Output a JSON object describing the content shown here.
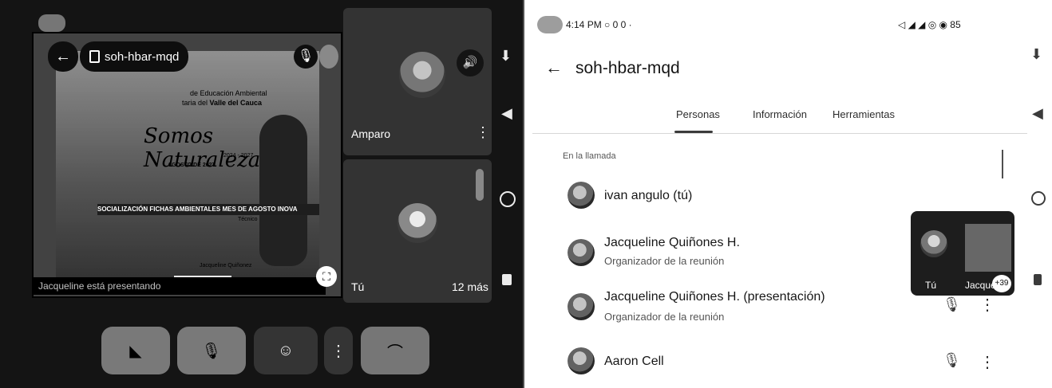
{
  "left_panel": {
    "meeting_code": "soh-hbar-mqd",
    "presentation": {
      "header_line1": "de Educación Ambiental",
      "header_line2_prefix": "taria del ",
      "header_line2_bold": "Valle del Cauca",
      "title": "Somos Naturaleza",
      "years": "2024 - 2027",
      "date": "AGOSTO DE 2027",
      "banner": "SOCIALIZACIÓN FICHAS AMBIENTALES MES DE AGOSTO INOVA",
      "banner_sub": "Técnico",
      "speaker": "Jacqueline Quiñonez",
      "caption": "Jacqueline está presentando"
    },
    "tiles": [
      {
        "name": "Amparo"
      },
      {
        "name": "Tú",
        "more": "12 más"
      }
    ]
  },
  "right_panel": {
    "status_bar_time": "4:14 PM",
    "status_bar_icons": "○ 0 0 ·",
    "status_bar_right": "◁ ◢ ◢ ◎ ◉ 85",
    "meeting_code": "soh-hbar-mqd",
    "tabs": [
      {
        "label": "Personas",
        "active": true
      },
      {
        "label": "Información",
        "active": false
      },
      {
        "label": "Herramientas",
        "active": false
      }
    ],
    "section_label": "En la llamada",
    "participants": [
      {
        "name": "ivan angulo (tú)",
        "subtitle": ""
      },
      {
        "name": "Jacqueline Quiñones H.",
        "subtitle": "Organizador de la reunión"
      },
      {
        "name": "Jacqueline Quiñones H. (presentación)",
        "subtitle": "Organizador de la reunión"
      },
      {
        "name": "Aaron Cell",
        "subtitle": ""
      }
    ],
    "pip": {
      "self_label": "Tú",
      "other_label": "Jacque",
      "count": "+39"
    }
  }
}
